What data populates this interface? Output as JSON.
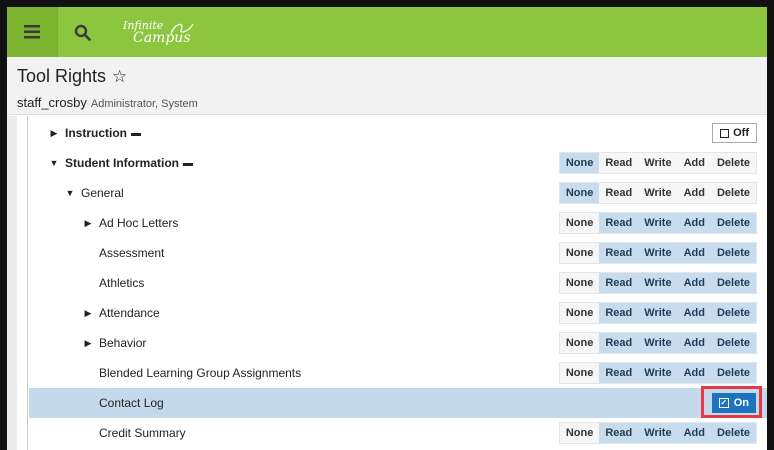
{
  "app": {
    "logo_line1": "Infinite",
    "logo_line2": "Campus"
  },
  "icons": {
    "menu": "hamburger-menu-icon",
    "search": "search-icon",
    "star": "star-outline-icon",
    "folder": "folder-icon",
    "caret_right": "caret-right-icon",
    "caret_down": "caret-down-icon",
    "checkbox_empty": "checkbox-empty-icon",
    "checkbox_checked": "checkbox-checked-icon"
  },
  "colors": {
    "topbar": "#8cc63f",
    "selected_row": "#c4d9ec",
    "on_button": "#1e73be",
    "highlight": "#e63946"
  },
  "page": {
    "title": "Tool Rights",
    "user": "staff_crosby",
    "role": "Administrator, System"
  },
  "tree": {
    "rows": [
      {
        "label": "Instruction",
        "control": "toggle-off",
        "toggle_label": "Off"
      },
      {
        "label": "Student Information",
        "perm": [
          "None",
          "Read",
          "Write",
          "Add",
          "Delete"
        ],
        "selected_level": "None"
      },
      {
        "label": "General",
        "perm": [
          "None",
          "Read",
          "Write",
          "Add",
          "Delete"
        ],
        "selected_level": "None"
      },
      {
        "label": "Ad Hoc Letters",
        "perm": [
          "None",
          "Read",
          "Write",
          "Add",
          "Delete"
        ],
        "selected_level": "Delete"
      },
      {
        "label": "Assessment",
        "perm": [
          "None",
          "Read",
          "Write",
          "Add",
          "Delete"
        ],
        "selected_level": "Delete"
      },
      {
        "label": "Athletics",
        "perm": [
          "None",
          "Read",
          "Write",
          "Add",
          "Delete"
        ],
        "selected_level": "Delete"
      },
      {
        "label": "Attendance",
        "perm": [
          "None",
          "Read",
          "Write",
          "Add",
          "Delete"
        ],
        "selected_level": "Delete"
      },
      {
        "label": "Behavior",
        "perm": [
          "None",
          "Read",
          "Write",
          "Add",
          "Delete"
        ],
        "selected_level": "Delete"
      },
      {
        "label": "Blended Learning Group Assignments",
        "perm": [
          "None",
          "Read",
          "Write",
          "Add",
          "Delete"
        ],
        "selected_level": "Delete"
      },
      {
        "label": "Contact Log",
        "control": "toggle-on",
        "toggle_label": "On"
      },
      {
        "label": "Credit Summary",
        "perm": [
          "None",
          "Read",
          "Write",
          "Add",
          "Delete"
        ],
        "selected_level": "Delete"
      }
    ]
  }
}
